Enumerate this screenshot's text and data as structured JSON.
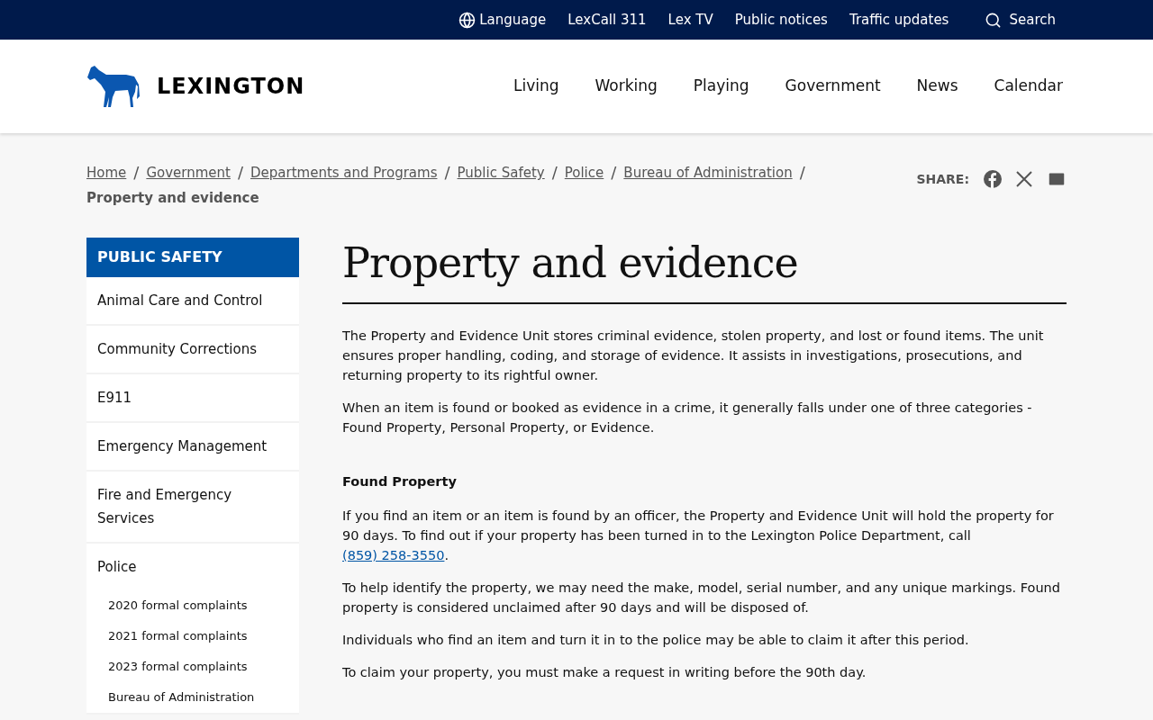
{
  "utility_bar": {
    "language": "Language",
    "links": [
      "LexCall 311",
      "Lex TV",
      "Public notices",
      "Traffic updates"
    ],
    "search": "Search"
  },
  "header": {
    "logo": "LEXINGTON",
    "nav": [
      "Living",
      "Working",
      "Playing",
      "Government",
      "News",
      "Calendar"
    ]
  },
  "breadcrumbs": {
    "links": [
      "Home",
      "Government",
      "Departments and Programs",
      "Public Safety",
      "Police",
      "Bureau of Administration"
    ],
    "separator": "/",
    "current": "Property and evidence"
  },
  "share": {
    "label": "SHARE:"
  },
  "sidebar": {
    "title": "PUBLIC SAFETY",
    "items": [
      {
        "label": "Animal Care and Control"
      },
      {
        "label": "Community Corrections"
      },
      {
        "label": "E911"
      },
      {
        "label": "Emergency Management"
      },
      {
        "label": "Fire and Emergency Services"
      },
      {
        "label": "Police",
        "children": [
          {
            "label": "2020 formal complaints"
          },
          {
            "label": "2021 formal complaints"
          },
          {
            "label": "2023 formal complaints"
          },
          {
            "label": "Bureau of Administration"
          }
        ]
      }
    ]
  },
  "content": {
    "title": "Property and evidence",
    "blocks": [
      {
        "kind": "paragraph",
        "text": "The Property and Evidence Unit stores criminal evidence, stolen property, and lost or found items. The unit ensures proper handling, coding, and storage of evidence. It assists in investigations, prosecutions, and returning property to its rightful owner."
      },
      {
        "kind": "paragraph",
        "text": "When an item is found or booked as evidence in a crime, it generally falls under one of three categories - Found Property, Personal Property, or Evidence."
      },
      {
        "kind": "heading",
        "text": "Found Property"
      },
      {
        "kind": "paragraph",
        "text": "If you find an item or an item is found by an officer, the Property and Evidence Unit will hold the property for 90 days. To find out if your property has been turned in to the Lexington Police Department, call",
        "link": "(859) 258-3550",
        "after": "."
      },
      {
        "kind": "paragraph",
        "text": "To help identify the property, we may need the make, model, serial number, and any unique markings. Found property is considered unclaimed after 90 days and will be disposed of."
      },
      {
        "kind": "paragraph",
        "text": "Individuals who find an item and turn it in to the police may be able to claim it after this period."
      },
      {
        "kind": "paragraph",
        "text": "To claim your property, you must make a request in writing before the 90th day."
      }
    ]
  }
}
